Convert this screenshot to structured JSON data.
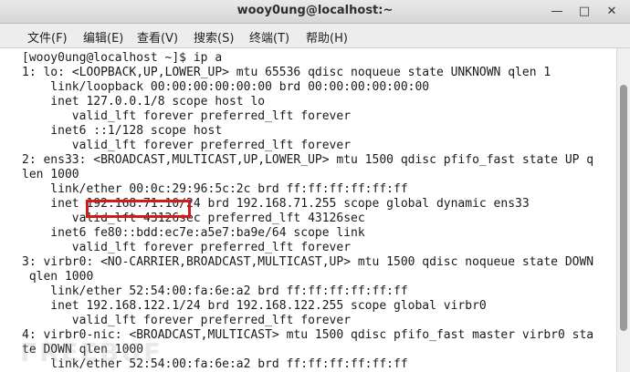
{
  "window": {
    "title": "wooy0ung@localhost:~",
    "minimize_glyph": "—",
    "maximize_glyph": "□",
    "close_glyph": "✕"
  },
  "menu": [
    "文件(F)",
    "编辑(E)",
    "查看(V)",
    "搜索(S)",
    "终端(T)",
    "帮助(H)"
  ],
  "terminal": {
    "lines": [
      "[wooy0ung@localhost ~]$ ip a",
      "1: lo: <LOOPBACK,UP,LOWER_UP> mtu 65536 qdisc noqueue state UNKNOWN qlen 1",
      "    link/loopback 00:00:00:00:00:00 brd 00:00:00:00:00:00",
      "    inet 127.0.0.1/8 scope host lo",
      "       valid_lft forever preferred_lft forever",
      "    inet6 ::1/128 scope host",
      "       valid_lft forever preferred_lft forever",
      "2: ens33: <BROADCAST,MULTICAST,UP,LOWER_UP> mtu 1500 qdisc pfifo_fast state UP q",
      "len 1000",
      "    link/ether 00:0c:29:96:5c:2c brd ff:ff:ff:ff:ff:ff",
      "    inet 192.168.71.10/24 brd 192.168.71.255 scope global dynamic ens33",
      "       valid_lft 43126sec preferred_lft 43126sec",
      "    inet6 fe80::bdd:ec7e:a5e7:ba9e/64 scope link",
      "       valid_lft forever preferred_lft forever",
      "3: virbr0: <NO-CARRIER,BROADCAST,MULTICAST,UP> mtu 1500 qdisc noqueue state DOWN",
      " qlen 1000",
      "    link/ether 52:54:00:fa:6e:a2 brd ff:ff:ff:ff:ff:ff",
      "    inet 192.168.122.1/24 brd 192.168.122.255 scope global virbr0",
      "       valid_lft forever preferred_lft forever",
      "4: virbr0-nic: <BROADCAST,MULTICAST> mtu 1500 qdisc pfifo_fast master virbr0 sta",
      "te DOWN qlen 1000",
      "    link/ether 52:54:00:fa:6e:a2 brd ff:ff:ff:ff:ff:ff"
    ],
    "highlighted_ip": "192.168.71.10",
    "highlight_color": "#d11a1a"
  },
  "watermark": "FREEBUF"
}
